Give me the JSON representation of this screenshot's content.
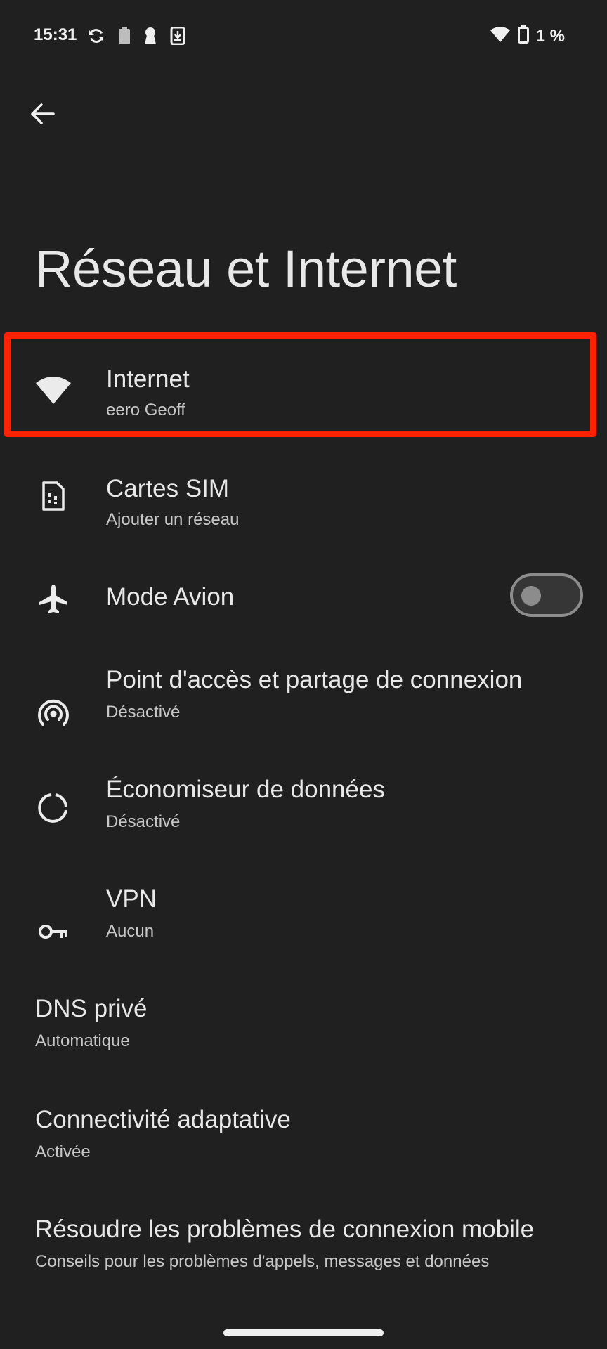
{
  "status_bar": {
    "time": "15:31",
    "battery_text": "1 %",
    "icons": [
      "sync-icon",
      "battery-saver-icon",
      "keyhole-icon",
      "download-icon",
      "wifi-icon",
      "battery-icon"
    ]
  },
  "header": {
    "back_icon": "arrow-left-icon",
    "title": "Réseau et Internet"
  },
  "items": [
    {
      "id": "internet",
      "icon": "wifi-icon",
      "title": "Internet",
      "subtitle": "eero Geoff",
      "highlighted": true
    },
    {
      "id": "sim",
      "icon": "sim-card-icon",
      "title": "Cartes SIM",
      "subtitle": "Ajouter un réseau"
    },
    {
      "id": "airplane",
      "icon": "airplane-icon",
      "title": "Mode Avion",
      "toggle": false
    },
    {
      "id": "hotspot",
      "icon": "hotspot-icon",
      "title": "Point d'accès et partage de connexion",
      "subtitle": "Désactivé"
    },
    {
      "id": "data-saver",
      "icon": "data-saver-icon",
      "title": "Économiseur de données",
      "subtitle": "Désactivé"
    },
    {
      "id": "vpn",
      "icon": "key-icon",
      "title": "VPN",
      "subtitle": "Aucun"
    },
    {
      "id": "private-dns",
      "title": "DNS privé",
      "subtitle": "Automatique"
    },
    {
      "id": "adaptive",
      "title": "Connectivité adaptative",
      "subtitle": "Activée"
    },
    {
      "id": "troubleshoot",
      "title": "Résoudre les problèmes de connexion mobile",
      "subtitle": "Conseils pour les problèmes d'appels, messages et données"
    }
  ],
  "colors": {
    "background": "#202020",
    "highlight": "#ff2200",
    "text": "#e8e8e8",
    "subtext": "#c7c7c7"
  }
}
